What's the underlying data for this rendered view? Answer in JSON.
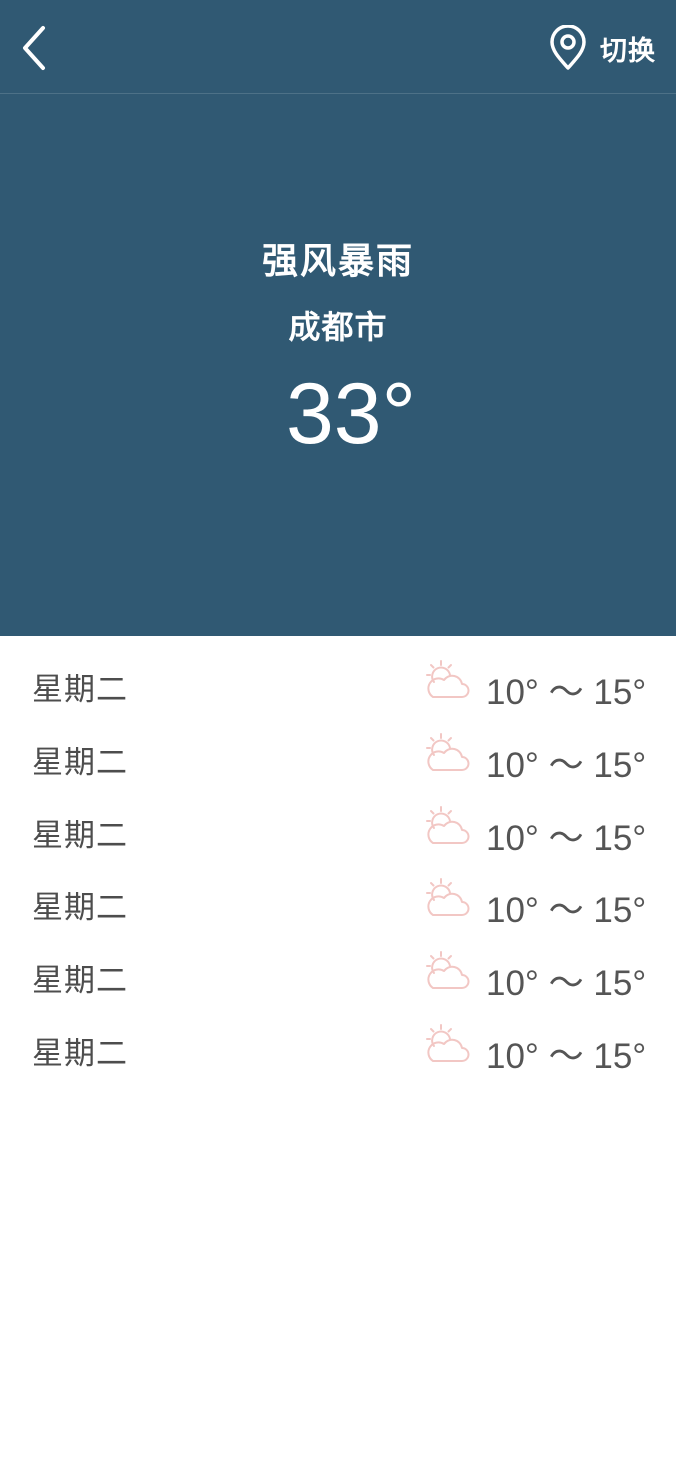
{
  "header": {
    "switch_label": "切换"
  },
  "current": {
    "condition": "强风暴雨",
    "city": "成都市",
    "temperature": "33°"
  },
  "forecast": [
    {
      "day": "星期二",
      "icon": "partly-cloudy-icon",
      "range": "10° ～ 15°"
    },
    {
      "day": "星期二",
      "icon": "partly-cloudy-icon",
      "range": "10° ～ 15°"
    },
    {
      "day": "星期二",
      "icon": "partly-cloudy-icon",
      "range": "10° ～ 15°"
    },
    {
      "day": "星期二",
      "icon": "partly-cloudy-icon",
      "range": "10° ～ 15°"
    },
    {
      "day": "星期二",
      "icon": "partly-cloudy-icon",
      "range": "10° ～ 15°"
    },
    {
      "day": "星期二",
      "icon": "partly-cloudy-icon",
      "range": "10° ～ 15°"
    }
  ],
  "colors": {
    "hero_background": "#305973",
    "text_on_hero": "#ffffff",
    "forecast_text": "#4d4d4d",
    "weather_icon": "#f2c7c4"
  }
}
